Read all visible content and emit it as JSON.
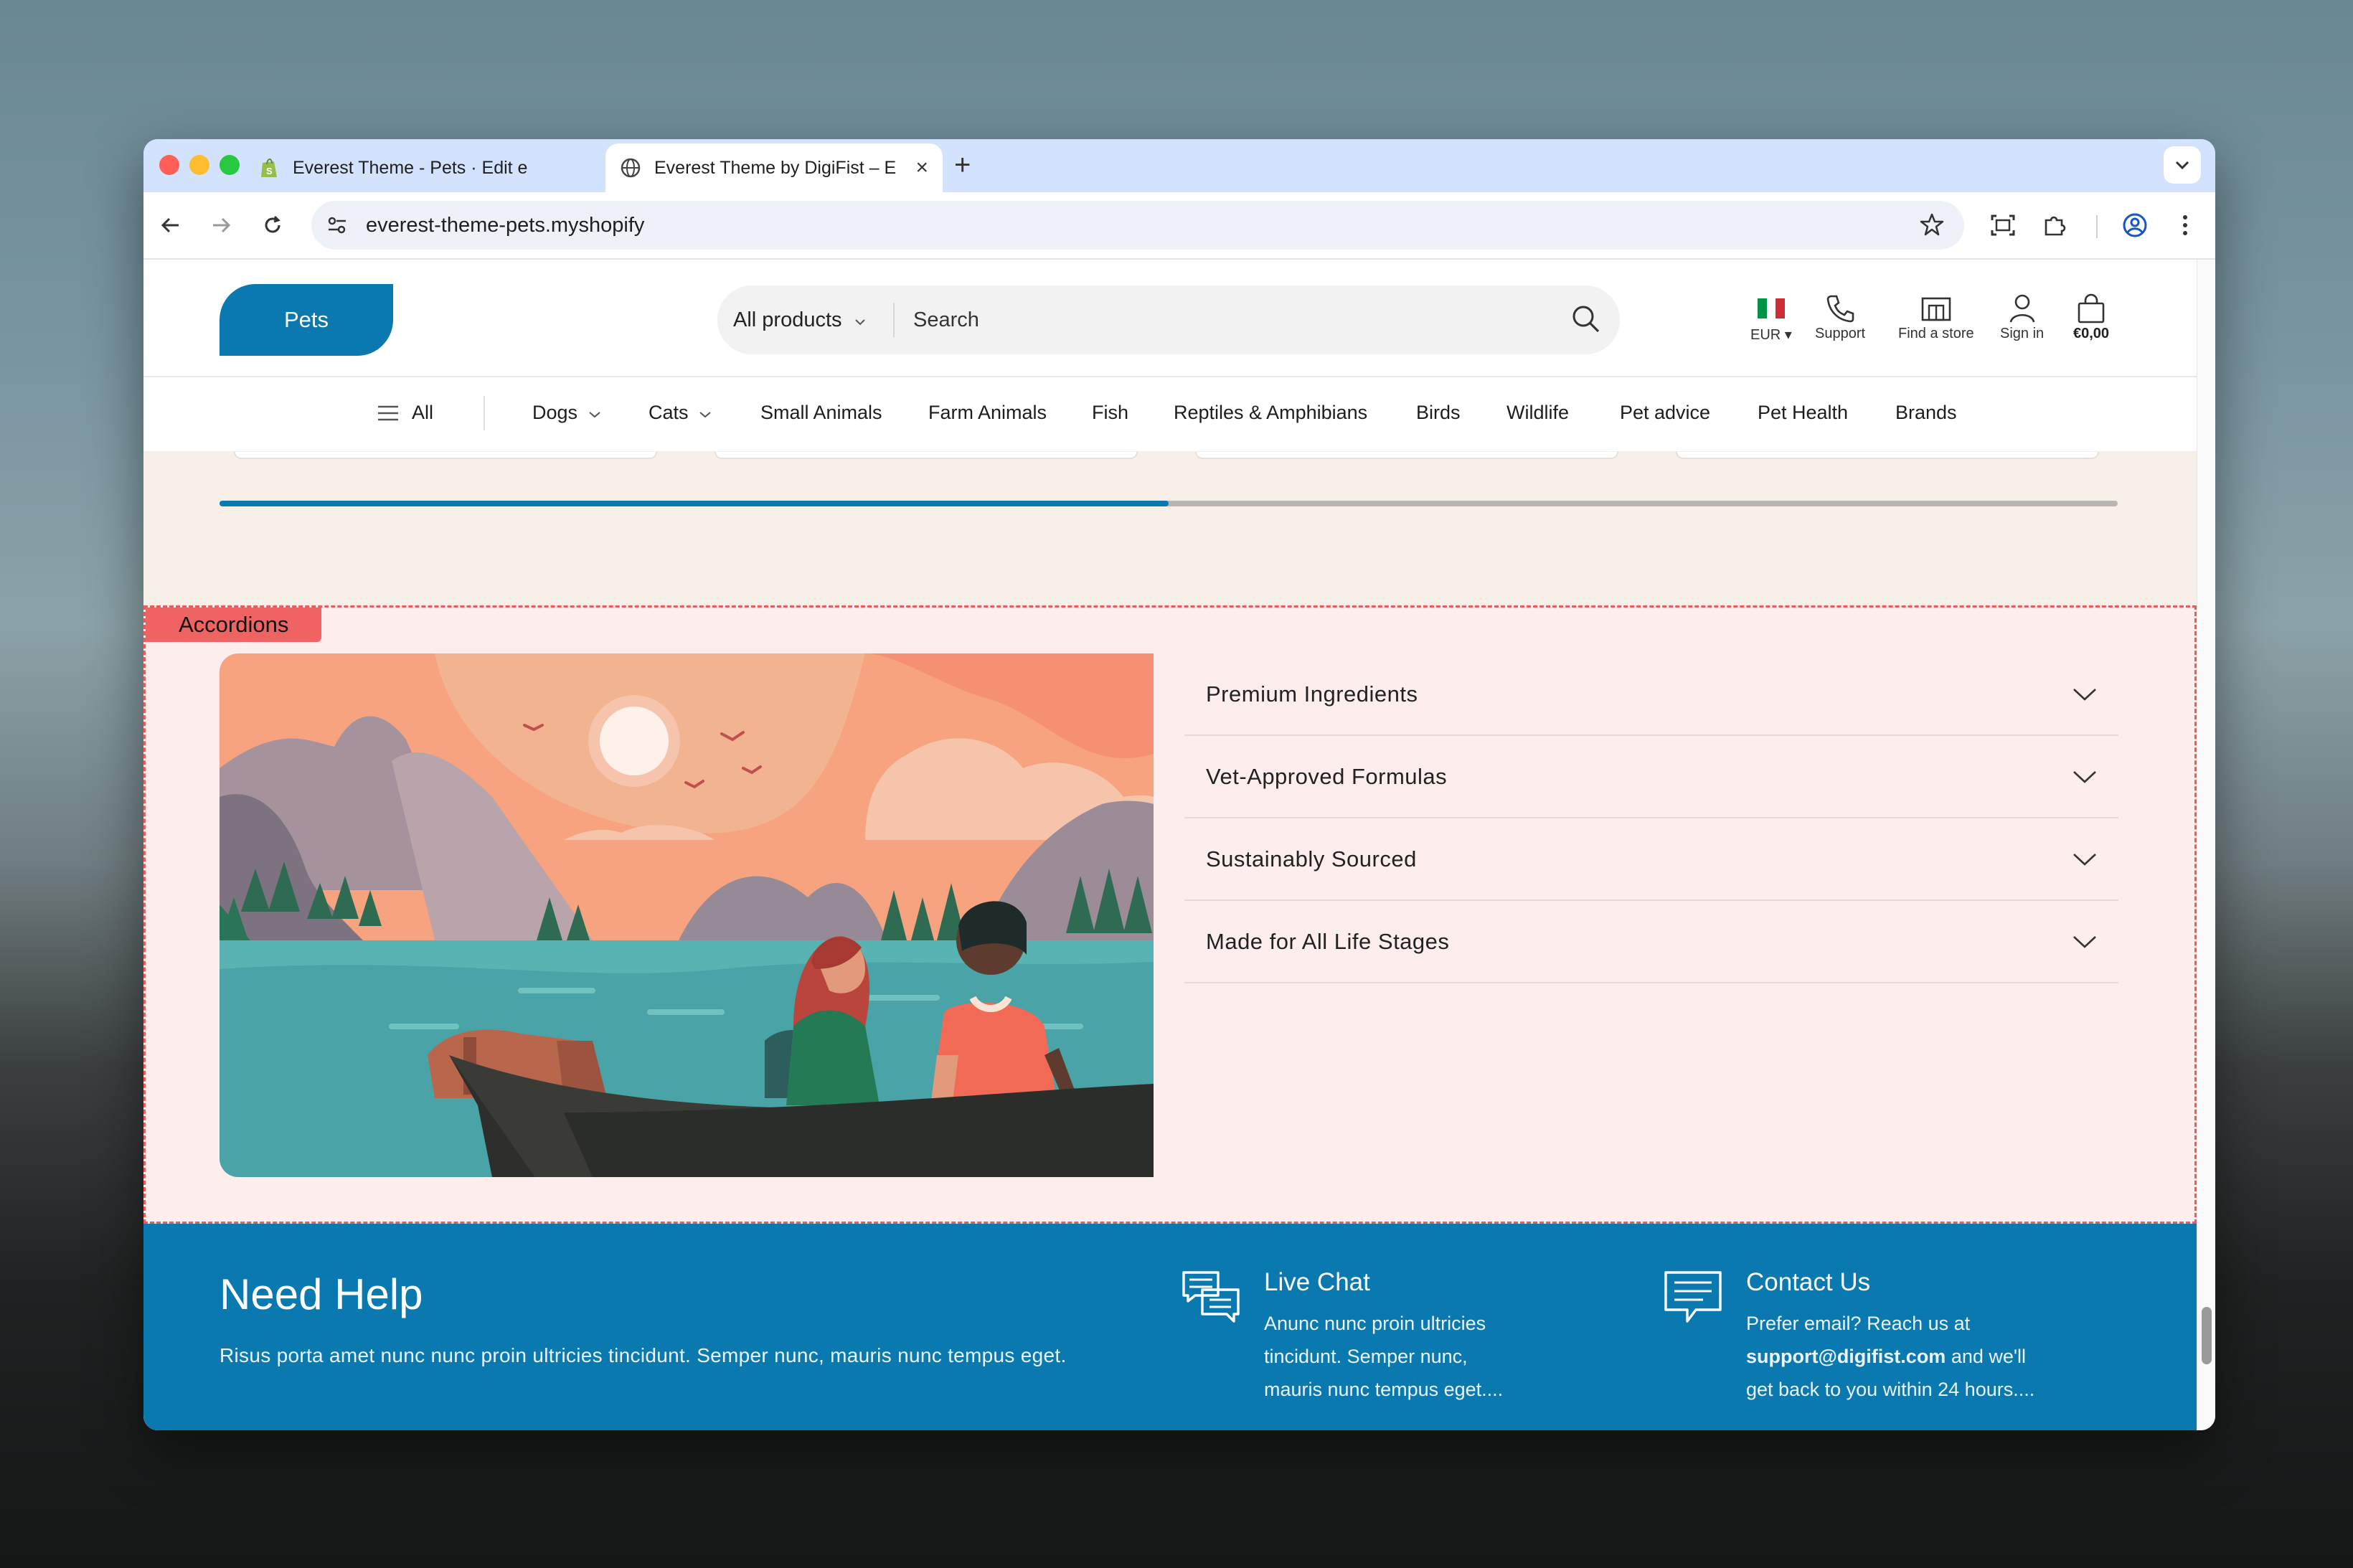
{
  "browser": {
    "tabs": [
      {
        "title": "Everest Theme - Pets · Edit e",
        "active": false
      },
      {
        "title": "Everest Theme by DigiFist – E",
        "active": true
      }
    ],
    "url": "everest-theme-pets.myshopify"
  },
  "site": {
    "logo": "Pets",
    "search": {
      "category": "All products",
      "placeholder": "Search"
    },
    "header_actions": {
      "currency": "EUR ▾",
      "support": "Support",
      "find_store": "Find a store",
      "sign_in": "Sign in",
      "cart": "€0,00"
    },
    "nav": [
      "All",
      "Dogs",
      "Cats",
      "Small Animals",
      "Farm Animals",
      "Fish",
      "Reptiles & Amphibians",
      "Birds",
      "Wildlife",
      "Pet advice",
      "Pet Health",
      "Brands"
    ],
    "slider_progress": 0.5
  },
  "accordions": {
    "tag": "Accordions",
    "items": [
      "Premium Ingredients",
      "Vet-Approved Formulas",
      "Sustainably Sourced",
      "Made for All Life Stages"
    ]
  },
  "help": {
    "title": "Need Help",
    "description": "Risus porta amet nunc nunc proin ultricies tincidunt. Semper nunc, mauris nunc tempus eget.",
    "live_chat": {
      "title": "Live Chat",
      "lines": [
        "Anunc nunc proin ultricies",
        "tincidunt. Semper nunc,",
        "mauris nunc tempus eget...."
      ]
    },
    "contact": {
      "title": "Contact Us",
      "line1": "Prefer email? Reach us at",
      "email": "support@digifist.com",
      "line2_suffix": " and we'll",
      "line3": "get back to you within 24 hours...."
    }
  },
  "colors": {
    "brand": "#0a79b0",
    "accordion_bg": "#fdeded",
    "beige": "#f7f0e9"
  }
}
